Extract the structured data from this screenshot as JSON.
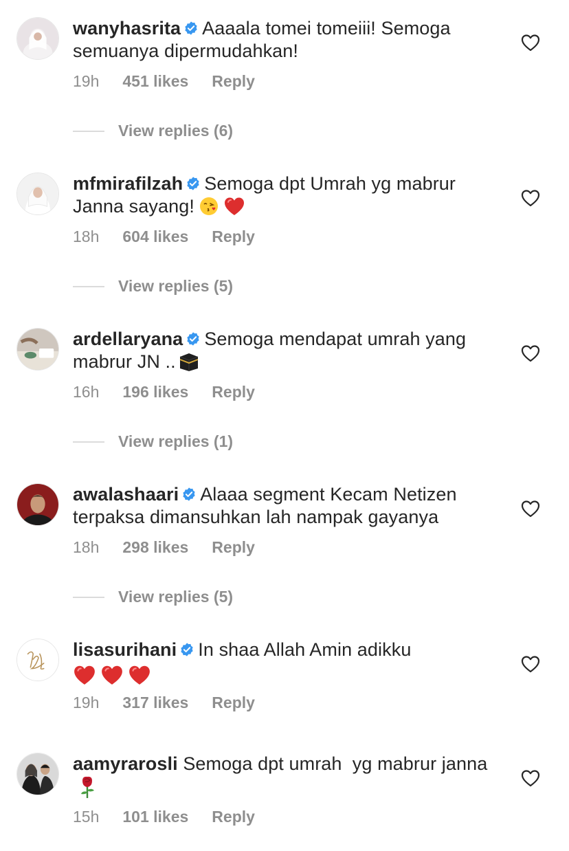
{
  "comments": [
    {
      "username": "wanyhasrita",
      "text": "Aaaala tomei tomeiii! Semoga semuanya dipermudahkan!",
      "emoji": "",
      "time": "19h",
      "likes": "451 likes",
      "reply": "Reply",
      "view_replies": "View replies (6)"
    },
    {
      "username": "mfmirafilzah",
      "text": "Semoga dpt Umrah yg mabrur Janna sayang!",
      "emoji": "kissing-face-heart red-heart",
      "time": "18h",
      "likes": "604 likes",
      "reply": "Reply",
      "view_replies": "View replies (5)"
    },
    {
      "username": "ardellaryana",
      "text": "Semoga mendapat umrah yang mabrur JN ..",
      "emoji": "kaaba",
      "time": "16h",
      "likes": "196 likes",
      "reply": "Reply",
      "view_replies": "View replies (1)"
    },
    {
      "username": "awalashaari",
      "text": "Alaaa segment Kecam Netizen terpaksa dimansuhkan lah nampak gayanya",
      "emoji": "",
      "time": "18h",
      "likes": "298 likes",
      "reply": "Reply",
      "view_replies": "View replies (5)"
    },
    {
      "username": "lisasurihani",
      "text": "In shaa Allah Amin adikku",
      "emoji": "red-heart red-heart red-heart",
      "time": "19h",
      "likes": "317 likes",
      "reply": "Reply",
      "view_replies": ""
    },
    {
      "username": "aamyrarosli",
      "text": "Semoga dpt umrah  yg mabrur janna",
      "emoji": "rose",
      "time": "15h",
      "likes": "101 likes",
      "reply": "Reply",
      "view_replies": ""
    }
  ],
  "colors": {
    "text": "#262626",
    "muted": "#8e8e8e",
    "verified": "#3897f0",
    "divider": "#dbdbdb"
  }
}
